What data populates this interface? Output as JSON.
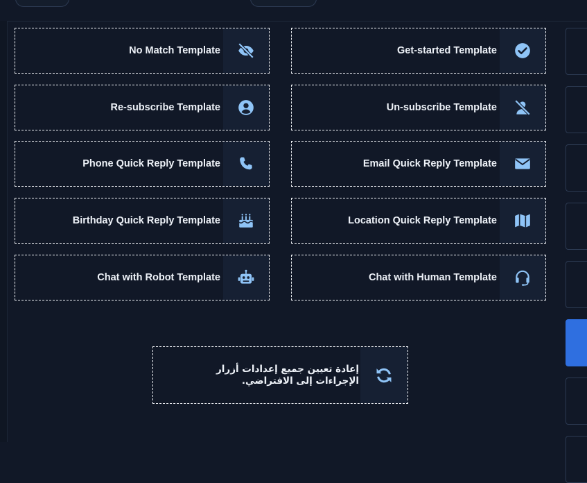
{
  "colors": {
    "background": "#111827",
    "card_border": "#f2f4f8",
    "icon_panel": "#162033",
    "icon_color": "#8fc4f7",
    "active_tab": "#2f6fe0"
  },
  "templates": [
    {
      "label": "No Match Template",
      "icon": "eye-slash-icon"
    },
    {
      "label": "Get-started Template",
      "icon": "check-circle-icon"
    },
    {
      "label": "Re-subscribe Template",
      "icon": "user-circle-icon"
    },
    {
      "label": "Un-subscribe Template",
      "icon": "user-slash-icon"
    },
    {
      "label": "Phone Quick Reply Template",
      "icon": "phone-icon"
    },
    {
      "label": "Email Quick Reply Template",
      "icon": "envelope-icon"
    },
    {
      "label": "Birthday Quick Reply Template",
      "icon": "birthday-cake-icon"
    },
    {
      "label": "Location Quick Reply Template",
      "icon": "map-icon"
    },
    {
      "label": "Chat with Robot Template",
      "icon": "robot-icon"
    },
    {
      "label": "Chat with Human Template",
      "icon": "headset-icon"
    }
  ],
  "reset": {
    "label": "إعادة تعيين جميع إعدادات أزرار الإجراءات إلى الافتراضي.",
    "icon": "refresh-icon"
  },
  "side_tabs": {
    "active_index": 5
  }
}
